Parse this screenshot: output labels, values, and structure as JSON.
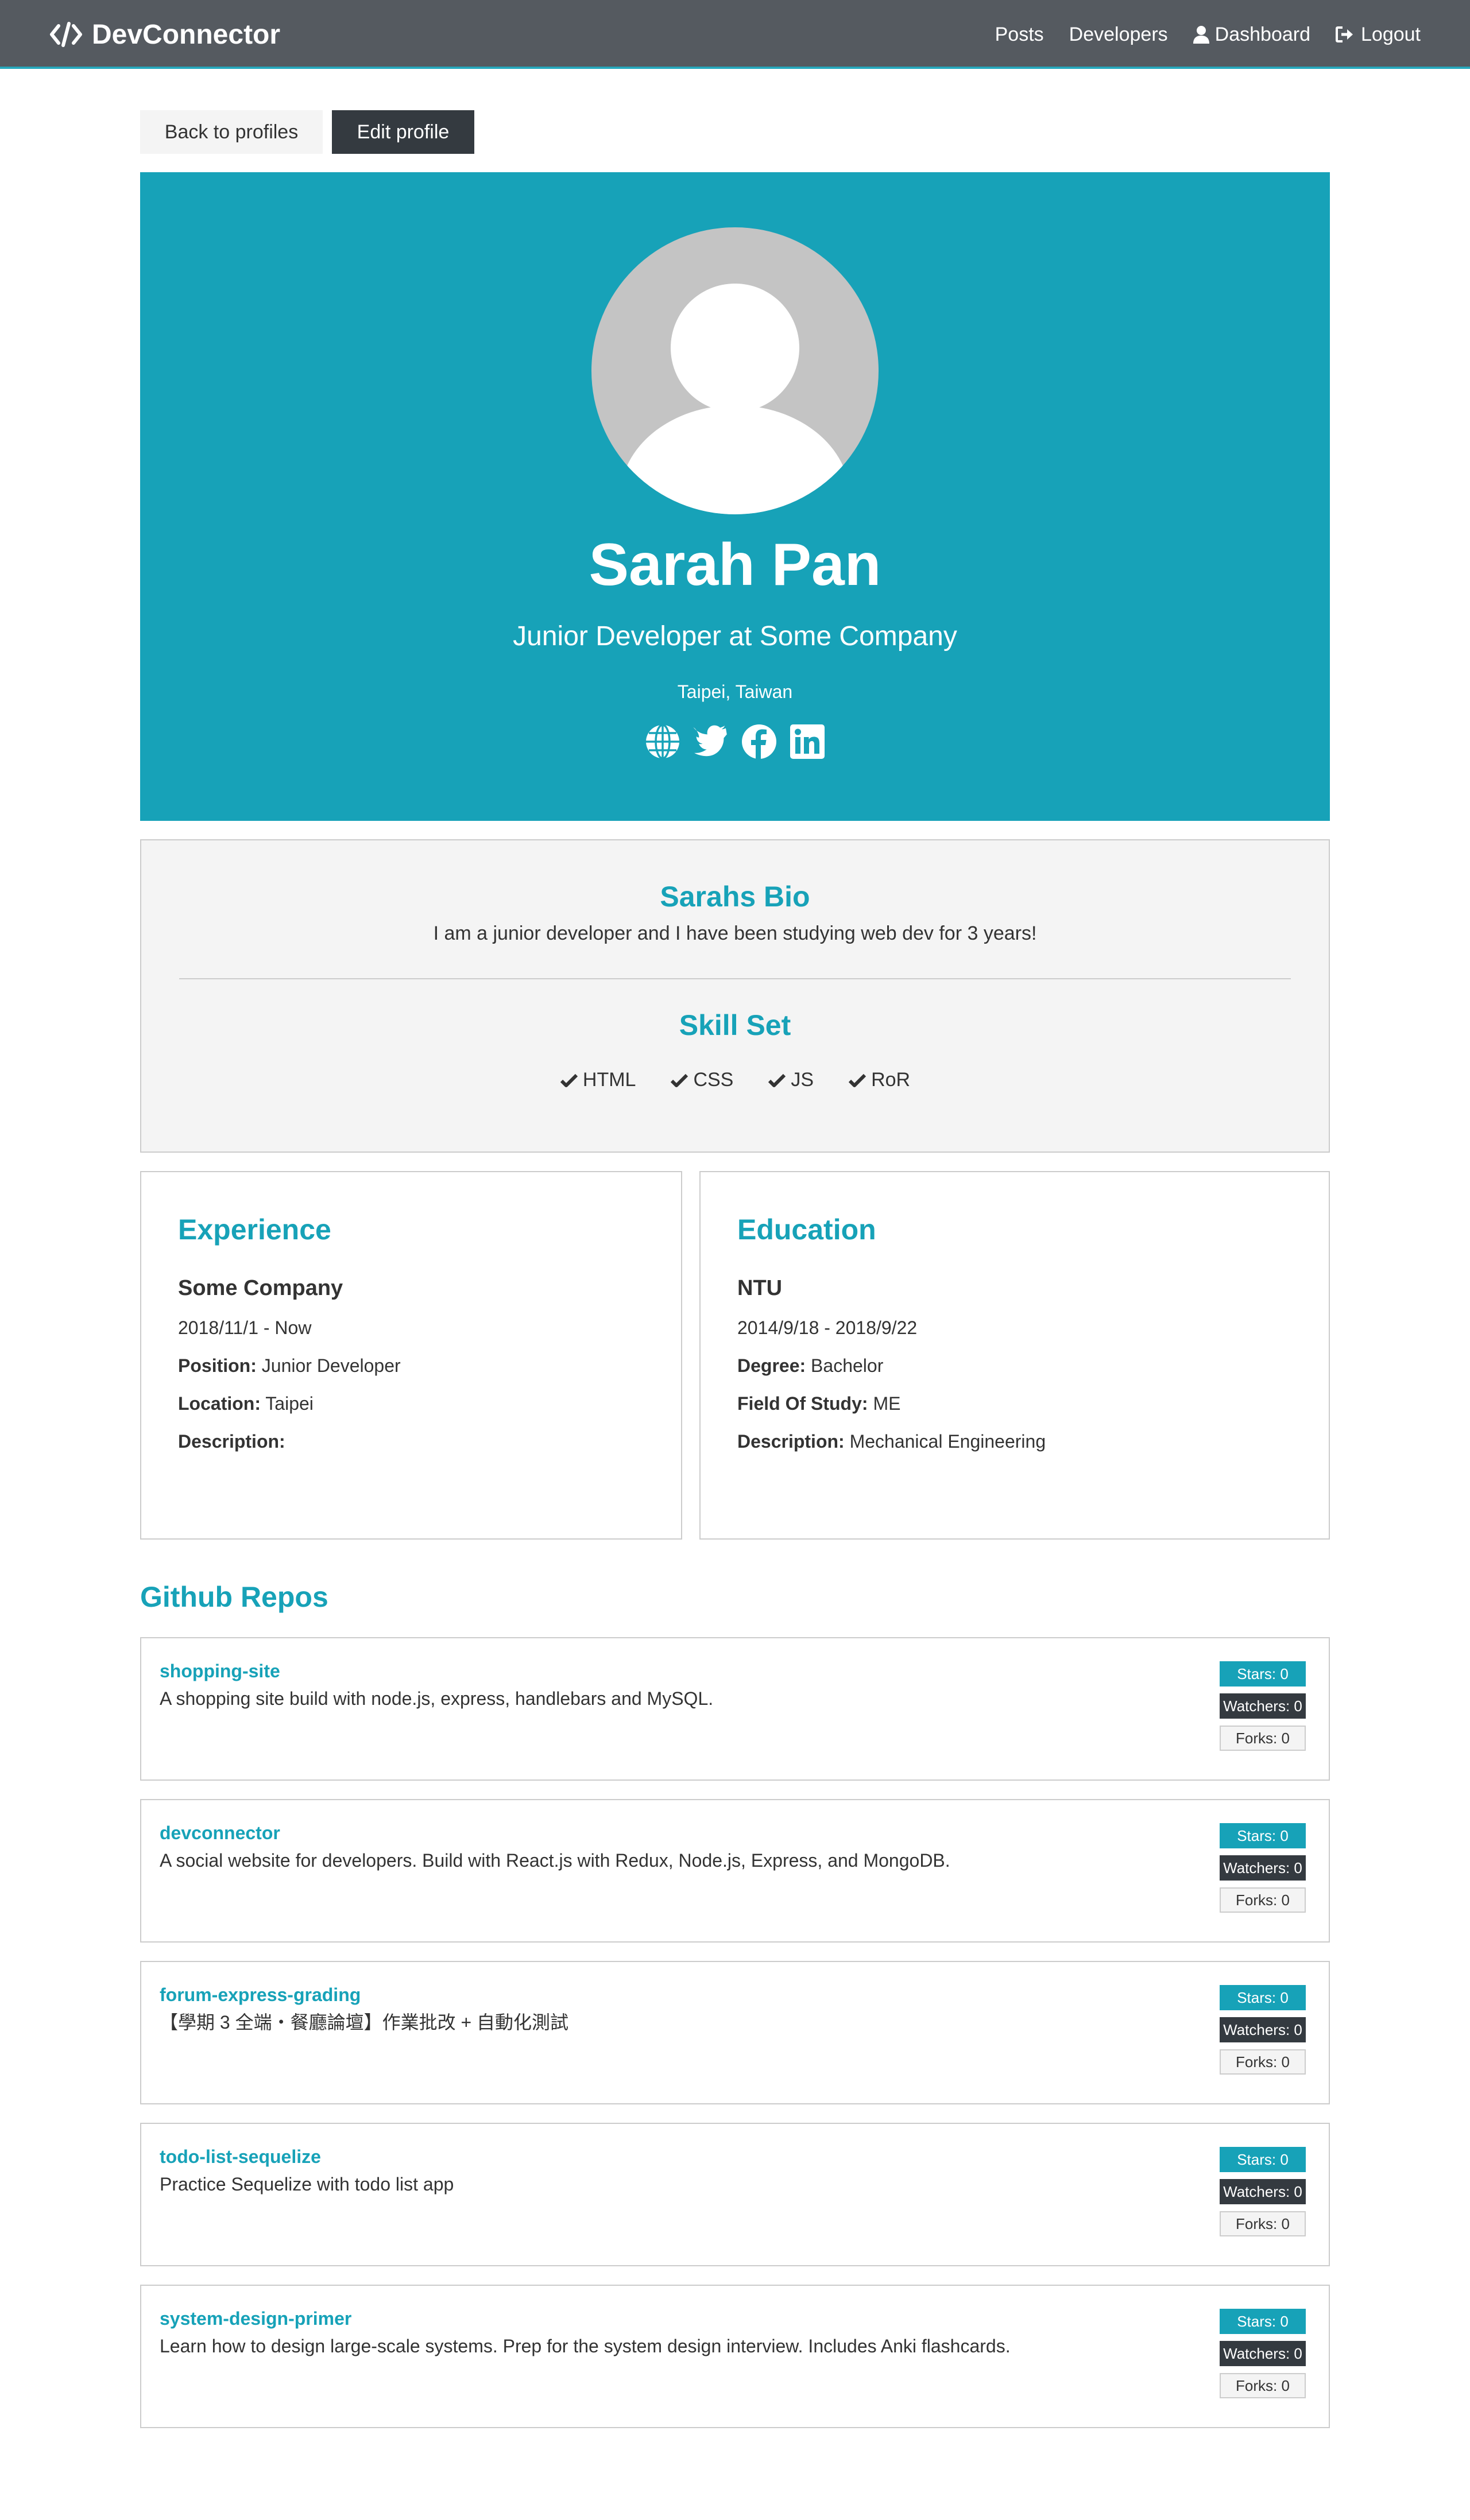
{
  "navbar": {
    "brand": "DevConnector",
    "links": [
      {
        "label": "Posts"
      },
      {
        "label": "Developers"
      },
      {
        "label": "Dashboard"
      },
      {
        "label": "Logout"
      }
    ]
  },
  "buttons": {
    "back": "Back to profiles",
    "edit": "Edit profile"
  },
  "profile": {
    "name": "Sarah Pan",
    "status": "Junior Developer at Some Company",
    "location": "Taipei, Taiwan",
    "social_icons": [
      "globe-icon",
      "twitter-icon",
      "facebook-icon",
      "linkedin-icon"
    ]
  },
  "about": {
    "bio_title": "Sarahs Bio",
    "bio": "I am a junior developer and I have been studying web dev for 3 years!",
    "skills_title": "Skill Set",
    "skills": [
      "HTML",
      "CSS",
      "JS",
      "RoR"
    ]
  },
  "experience": {
    "title": "Experience",
    "company": "Some Company",
    "dates": "2018/11/1 - Now",
    "position_label": "Position:",
    "position": "Junior Developer",
    "location_label": "Location:",
    "location": "Taipei",
    "description_label": "Description:",
    "description": ""
  },
  "education": {
    "title": "Education",
    "school": "NTU",
    "dates": "2014/9/18 - 2018/9/22",
    "degree_label": "Degree:",
    "degree": "Bachelor",
    "field_label": "Field Of Study:",
    "field": "ME",
    "description_label": "Description:",
    "description": "Mechanical Engineering"
  },
  "repos": {
    "title": "Github Repos",
    "items": [
      {
        "name": "shopping-site",
        "description": "A shopping site build with node.js, express, handlebars and MySQL.",
        "stars": "Stars: 0",
        "watchers": "Watchers: 0",
        "forks": "Forks: 0"
      },
      {
        "name": "devconnector",
        "description": "A social website for developers. Build with React.js with Redux, Node.js, Express, and MongoDB.",
        "stars": "Stars: 0",
        "watchers": "Watchers: 0",
        "forks": "Forks: 0"
      },
      {
        "name": "forum-express-grading",
        "description": "【學期 3 全端・餐廳論壇】作業批改 + 自動化測試",
        "stars": "Stars: 0",
        "watchers": "Watchers: 0",
        "forks": "Forks: 0"
      },
      {
        "name": "todo-list-sequelize",
        "description": "Practice Sequelize with todo list app",
        "stars": "Stars: 0",
        "watchers": "Watchers: 0",
        "forks": "Forks: 0"
      },
      {
        "name": "system-design-primer",
        "description": "Learn how to design large-scale systems. Prep for the system design interview. Includes Anki flashcards.",
        "stars": "Stars: 0",
        "watchers": "Watchers: 0",
        "forks": "Forks: 0"
      }
    ]
  },
  "colors": {
    "primary": "#17a2b8",
    "dark": "#343a40",
    "light": "#f4f4f4"
  }
}
